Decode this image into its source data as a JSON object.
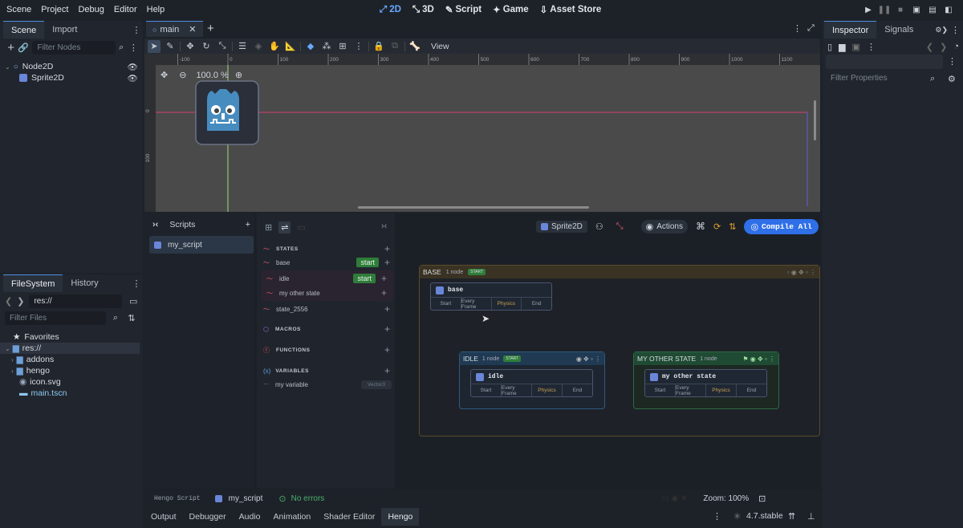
{
  "menu": [
    "Scene",
    "Project",
    "Debug",
    "Editor",
    "Help"
  ],
  "workspaces": [
    {
      "label": "2D",
      "icon": "2d-icon",
      "active": true
    },
    {
      "label": "3D",
      "icon": "3d-icon",
      "active": false
    },
    {
      "label": "Script",
      "icon": "script-icon",
      "active": false
    },
    {
      "label": "Game",
      "icon": "game-icon",
      "active": false
    },
    {
      "label": "Asset Store",
      "icon": "asset-store-icon",
      "active": false
    }
  ],
  "scene_dock": {
    "tabs": [
      "Scene",
      "Import"
    ],
    "filter_placeholder": "Filter Nodes",
    "nodes": [
      {
        "label": "Node2D",
        "icon": "node2d-icon"
      },
      {
        "label": "Sprite2D",
        "icon": "sprite2d-icon"
      }
    ]
  },
  "filesystem_dock": {
    "tabs": [
      "FileSystem",
      "History"
    ],
    "path": "res://",
    "filter_placeholder": "Filter Files",
    "items": [
      {
        "label": "Favorites",
        "icon": "star-icon"
      },
      {
        "label": "res://",
        "icon": "folder-icon"
      },
      {
        "label": "addons",
        "icon": "folder-icon"
      },
      {
        "label": "hengo",
        "icon": "folder-icon"
      },
      {
        "label": "icon.svg",
        "icon": "svg-file-icon"
      },
      {
        "label": "main.tscn",
        "icon": "scene-file-icon"
      }
    ]
  },
  "editor": {
    "scene_tab": "main",
    "toolbar_view": "View",
    "zoom": "100.0 %",
    "ruler_marks": [
      "-100",
      "0",
      "100",
      "200",
      "300",
      "400",
      "500",
      "600",
      "700",
      "800",
      "900",
      "1000",
      "1100"
    ],
    "vruler_marks": [
      "0",
      "100"
    ]
  },
  "inspector": {
    "tabs": [
      "Inspector",
      "Signals"
    ],
    "filter_placeholder": "Filter Properties"
  },
  "hengo": {
    "scripts_title": "Scripts",
    "scripts": [
      "my_script"
    ],
    "sections": {
      "states": "STATES",
      "macros": "MACROS",
      "functions": "FUNCTIONS",
      "variables": "VARIABLES"
    },
    "states": [
      {
        "label": "base",
        "badge": "start"
      },
      {
        "label": "idle",
        "badge": "start"
      },
      {
        "label": "my other state",
        "badge": ""
      },
      {
        "label": "state_2556",
        "badge": ""
      }
    ],
    "variables": [
      {
        "label": "my variable",
        "type": "Vector3"
      }
    ],
    "toolbar": {
      "node": "Sprite2D",
      "actions": "Actions",
      "compile": "Compile All"
    },
    "groups": [
      {
        "title": "BASE",
        "count": "1 node",
        "badge": "START"
      },
      {
        "title": "IDLE",
        "count": "1 node",
        "badge": "START"
      },
      {
        "title": "MY OTHER STATE",
        "count": "1 node",
        "badge": ""
      }
    ],
    "graph_nodes": [
      {
        "title": "base"
      },
      {
        "title": "idle"
      },
      {
        "title": "my other state"
      }
    ],
    "ports": [
      "Start",
      "Every Frame",
      "Physics",
      "End"
    ],
    "status": {
      "label": "Hengo Script",
      "script": "my_script",
      "errors": "No errors",
      "zoom": "Zoom: 100%"
    }
  },
  "bottom_tabs": [
    "Output",
    "Debugger",
    "Audio",
    "Animation",
    "Shader Editor",
    "Hengo"
  ],
  "version": "4.7.stable",
  "colors": {
    "accent": "#4e8de0",
    "compile": "#2f6fe8",
    "start_badge": "#2f7d3a",
    "base_group": "#3a3323",
    "idle_group": "#1f3a52",
    "other_group": "#1f4a33"
  }
}
